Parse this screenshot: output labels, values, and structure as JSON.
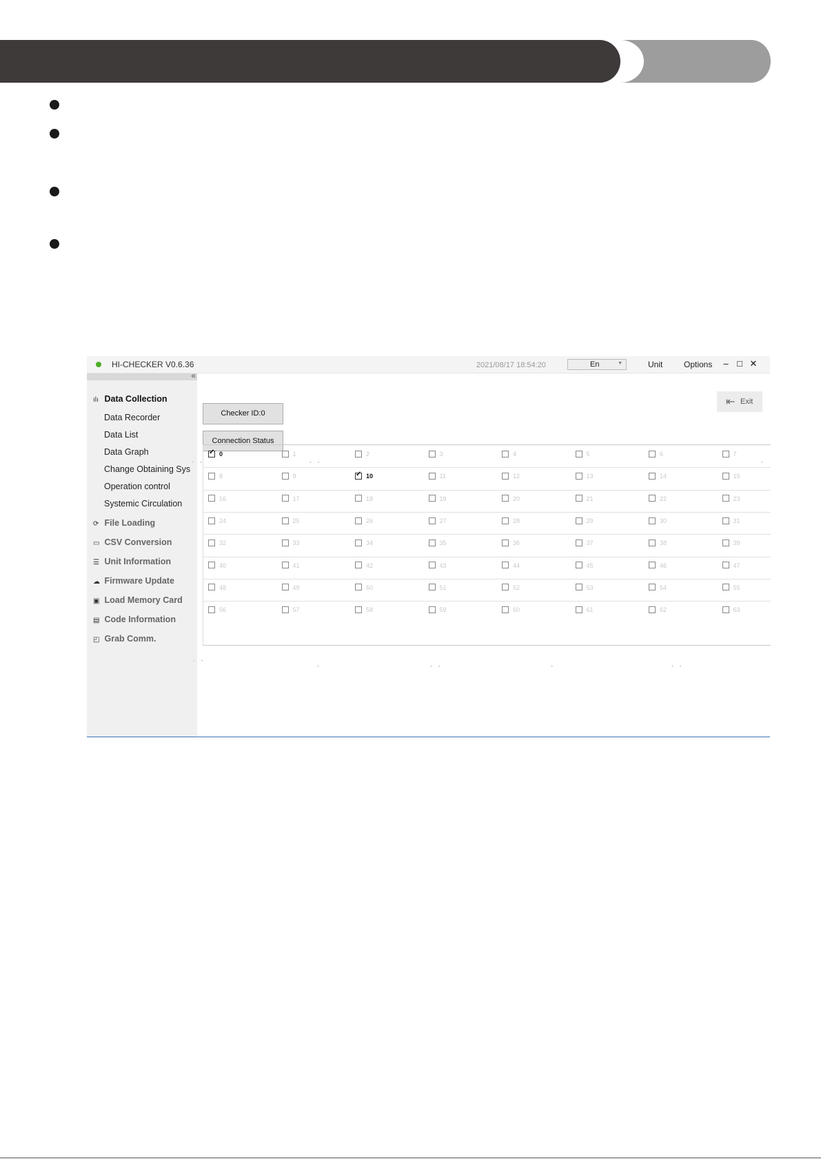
{
  "app": {
    "title": "HI-CHECKER V0.6.36",
    "datetime": "2021/08/17 18:54:20",
    "language": "En",
    "menu": [
      "Unit",
      "Options"
    ],
    "window_controls": {
      "minimize": "–",
      "maximize": "□",
      "close": "✕"
    },
    "status_color": "#4caf28"
  },
  "sidebar": {
    "collapse_label": "«",
    "sections": [
      {
        "label": "Data Collection",
        "icon": "bar-chart-icon",
        "glyph": "ılı",
        "active": true
      },
      {
        "label": "File Loading",
        "icon": "refresh-icon",
        "glyph": "⟳"
      },
      {
        "label": "CSV Conversion",
        "icon": "csv-icon",
        "glyph": "▭"
      },
      {
        "label": "Unit Information",
        "icon": "list-icon",
        "glyph": "☰"
      },
      {
        "label": "Firmware Update",
        "icon": "cloud-upload-icon",
        "glyph": "☁"
      },
      {
        "label": "Load Memory Card",
        "icon": "memory-card-icon",
        "glyph": "▣"
      },
      {
        "label": "Code Information",
        "icon": "code-icon",
        "glyph": "▤"
      },
      {
        "label": "Grab Comm.",
        "icon": "comm-icon",
        "glyph": "◰"
      }
    ],
    "sub_items": [
      "Data Recorder",
      "Data List",
      "Data Graph",
      "Change Obtaining Sys",
      "Operation control",
      "Systemic Circulation"
    ]
  },
  "main": {
    "checker_id_label": "Checker ID:0",
    "connection_status_label": "Connection Status",
    "exit_label": "Exit",
    "unit_columns": 8,
    "unit_rows": 8,
    "selected_units": [
      0,
      10
    ]
  },
  "colors": {
    "band_dark": "#3e3a39",
    "band_light": "#9d9d9d",
    "accent_line": "#3a74b5"
  }
}
